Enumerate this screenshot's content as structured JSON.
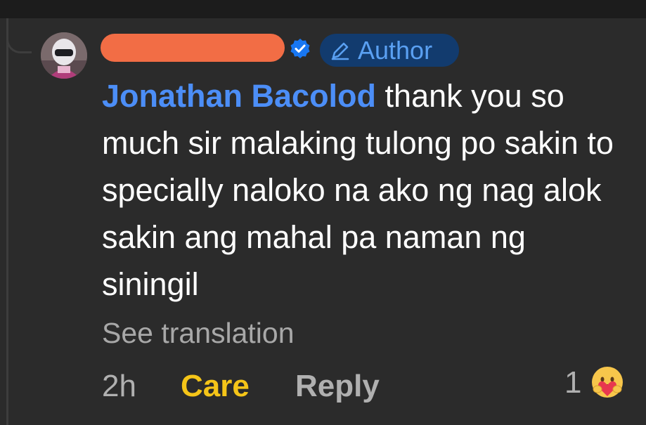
{
  "comment": {
    "author_badge": {
      "label": "Author",
      "icon": "pencil-icon"
    },
    "verified_icon": "verified-badge-icon",
    "mention": "Jonathan Bacolod",
    "body": " thank you so much sir malaking tulong po sakin to specially naloko na ako ng nag alok sakin ang mahal pa naman ng siningil",
    "see_translation": "See translation",
    "time": "2h",
    "actions": {
      "care": "Care",
      "reply": "Reply"
    },
    "reactions": {
      "count": "1",
      "emoji": "care-emoji-icon"
    }
  },
  "colors": {
    "background": "#2b2b2b",
    "mention": "#4c8ef7",
    "author_badge_bg": "#123b6e",
    "author_badge_text": "#5aa0f2",
    "care": "#f5c518",
    "redaction": "#f26d45"
  }
}
